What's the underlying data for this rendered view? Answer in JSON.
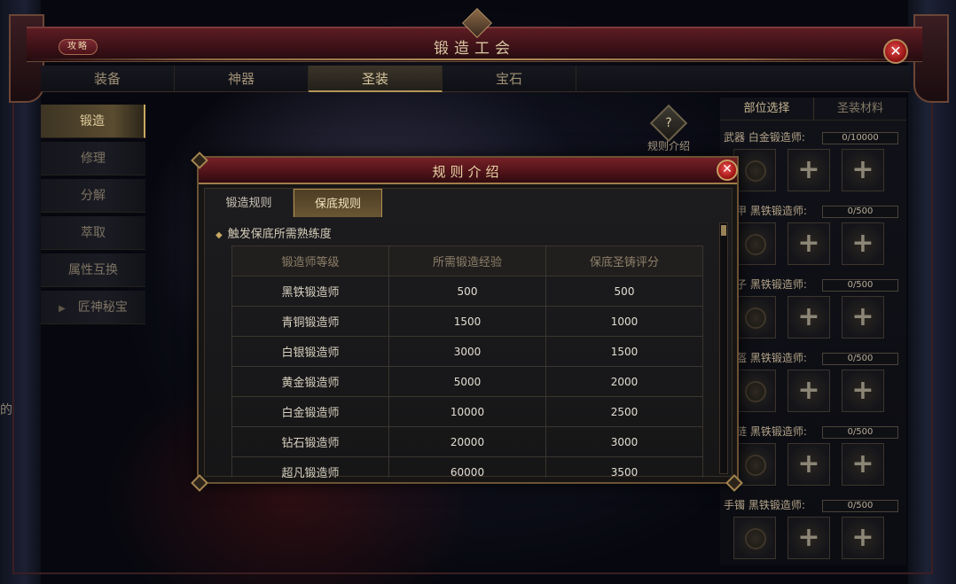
{
  "window": {
    "title": "锻造工会",
    "guide_label": "攻略",
    "close": "✕"
  },
  "main_tabs": [
    {
      "label": "装备"
    },
    {
      "label": "神器"
    },
    {
      "label": "圣装"
    },
    {
      "label": "宝石"
    }
  ],
  "side_menu": [
    {
      "label": "锻造"
    },
    {
      "label": "修理"
    },
    {
      "label": "分解"
    },
    {
      "label": "萃取"
    },
    {
      "label": "属性互换"
    },
    {
      "label": "匠神秘宝",
      "arrow": "▶"
    }
  ],
  "rules_icon": {
    "glyph": "?",
    "label": "规则介绍"
  },
  "right_panel": {
    "tabs": [
      {
        "label": "部位选择"
      },
      {
        "label": "圣装材料"
      }
    ],
    "slots": [
      {
        "part": "武器",
        "rank": "白金锻造师:",
        "progress": "0/10000"
      },
      {
        "part": "甲",
        "rank": "黑铁锻造师:",
        "progress": "0/500"
      },
      {
        "part": "子",
        "rank": "黑铁锻造师:",
        "progress": "0/500"
      },
      {
        "part": "盔",
        "rank": "黑铁锻造师:",
        "progress": "0/500"
      },
      {
        "part": "链",
        "rank": "黑铁锻造师:",
        "progress": "0/500"
      },
      {
        "part": "手镯",
        "rank": "黑铁锻造师:",
        "progress": "0/500"
      }
    ],
    "plus": "+"
  },
  "edge_text": "的",
  "modal": {
    "title": "规则介绍",
    "close": "✕",
    "tabs": [
      {
        "label": "锻造规则"
      },
      {
        "label": "保底规则"
      }
    ],
    "section_title": "触发保底所需熟练度",
    "section_marker": "◆",
    "table": {
      "headers": [
        "锻造师等级",
        "所需锻造经验",
        "保底圣铸评分"
      ],
      "rows": [
        [
          "黑铁锻造师",
          "500",
          "500"
        ],
        [
          "青铜锻造师",
          "1500",
          "1000"
        ],
        [
          "白银锻造师",
          "3000",
          "1500"
        ],
        [
          "黄金锻造师",
          "5000",
          "2000"
        ],
        [
          "白金锻造师",
          "10000",
          "2500"
        ],
        [
          "钻石锻造师",
          "20000",
          "3000"
        ],
        [
          "超凡锻造师",
          "60000",
          "3500"
        ]
      ]
    }
  }
}
